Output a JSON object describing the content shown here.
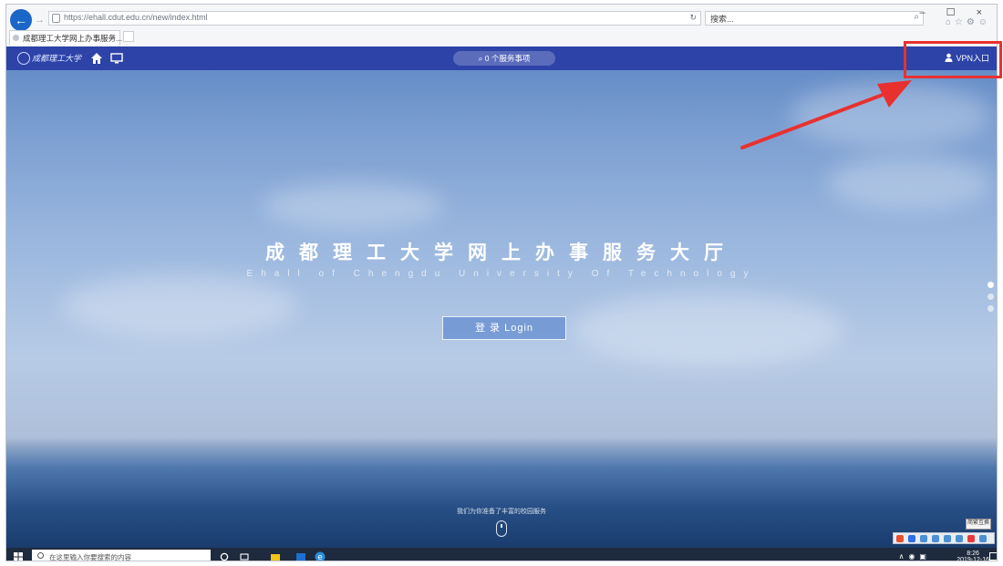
{
  "browser": {
    "url": "https://ehall.cdut.edu.cn/new/index.html",
    "search_placeholder": "搜索...",
    "tab_title": "成都理工大学网上办事服务...",
    "tab_close": "×",
    "window_controls": "– ☐ ×"
  },
  "nav": {
    "logo_text": "成都理工大学",
    "search_label": "0 个服务事项",
    "vpn_label": "VPN入口"
  },
  "hero": {
    "title": "成都理工大学网上办事服务大厅",
    "subtitle": "Ehall of Chengdu University Of Technology",
    "login_label": "登 录  Login",
    "hint": "我们为你准备了丰富的校园服务"
  },
  "ime": {
    "popup": "简繁互换"
  },
  "taskbar": {
    "search_placeholder": "在这里输入你要搜索的内容",
    "time": "8:26",
    "date": "2019-12-16"
  },
  "colors": {
    "nav_bar": "#2d43a8",
    "highlight": "#e8312f",
    "browser_back": "#1b66c9"
  }
}
